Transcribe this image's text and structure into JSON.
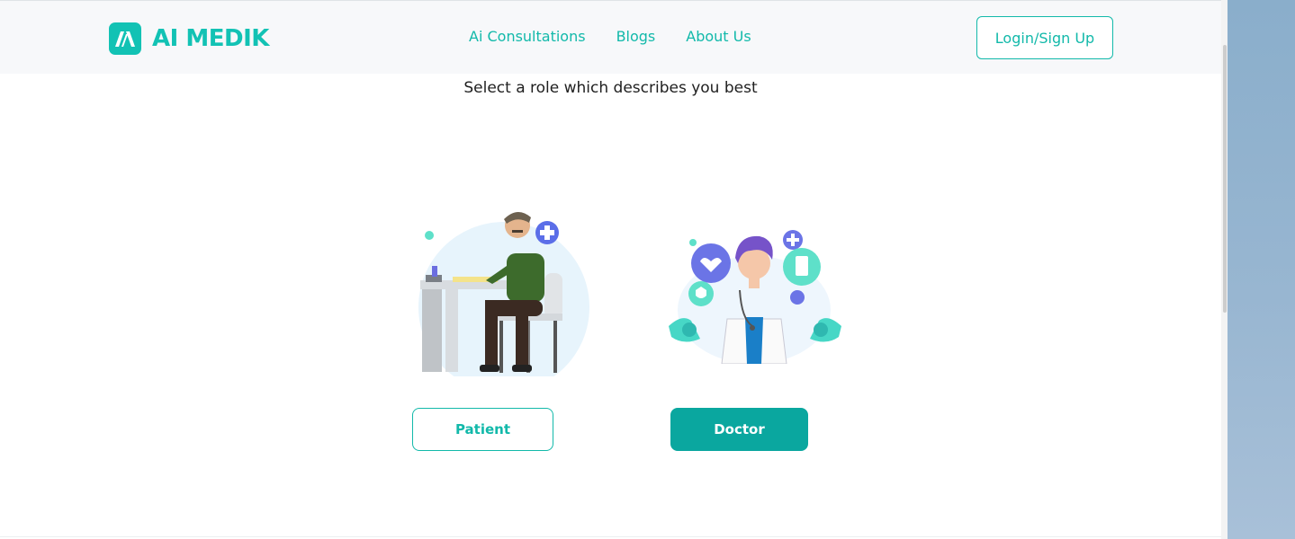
{
  "header": {
    "logo_text": "AI MEDIK",
    "nav": [
      "Ai Consultations",
      "Blogs",
      "About Us"
    ],
    "login_label": "Login/Sign Up"
  },
  "main": {
    "prompt": "Select a role which describes you best",
    "roles": [
      {
        "label": "Patient",
        "illustration": "patient-at-desk-illustration"
      },
      {
        "label": "Doctor",
        "illustration": "doctor-with-health-icons-illustration"
      }
    ]
  },
  "colors": {
    "brand": "#12c2b4",
    "brand_dark": "#0aa79f",
    "header_bg": "#f7f8fa",
    "text": "#1f1f1f"
  }
}
